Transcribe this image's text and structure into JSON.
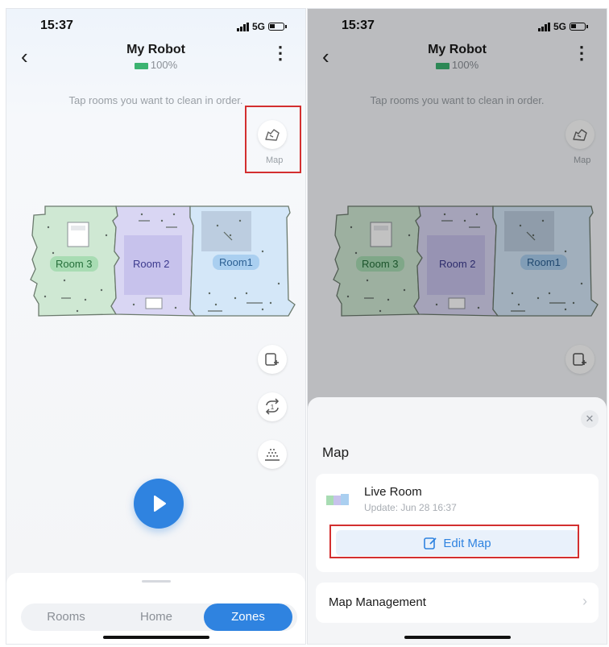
{
  "status": {
    "time": "15:37",
    "network": "5G"
  },
  "header": {
    "title": "My Robot",
    "battery": "100%"
  },
  "hint": "Tap rooms you want to clean in order.",
  "map_button": {
    "label": "Map",
    "icon": "map-icon"
  },
  "rooms": [
    {
      "label": "Room 3",
      "color": "#cfe8d3"
    },
    {
      "label": "Room 2",
      "color": "#d9d6f3"
    },
    {
      "label": "Room1",
      "color": "#d4e7f8"
    }
  ],
  "side_icons": [
    "add-zone-icon",
    "repeat-once-icon",
    "mop-icon"
  ],
  "tabs": {
    "items": [
      "Rooms",
      "Home",
      "Zones"
    ],
    "selected": "Zones"
  },
  "panel": {
    "title": "Map",
    "map_item": {
      "name": "Live Room",
      "update": "Update: Jun 28 16:37"
    },
    "edit_button": "Edit Map",
    "management": "Map Management"
  },
  "colors": {
    "accent": "#2f83e0",
    "highlight": "#d32f2f"
  }
}
